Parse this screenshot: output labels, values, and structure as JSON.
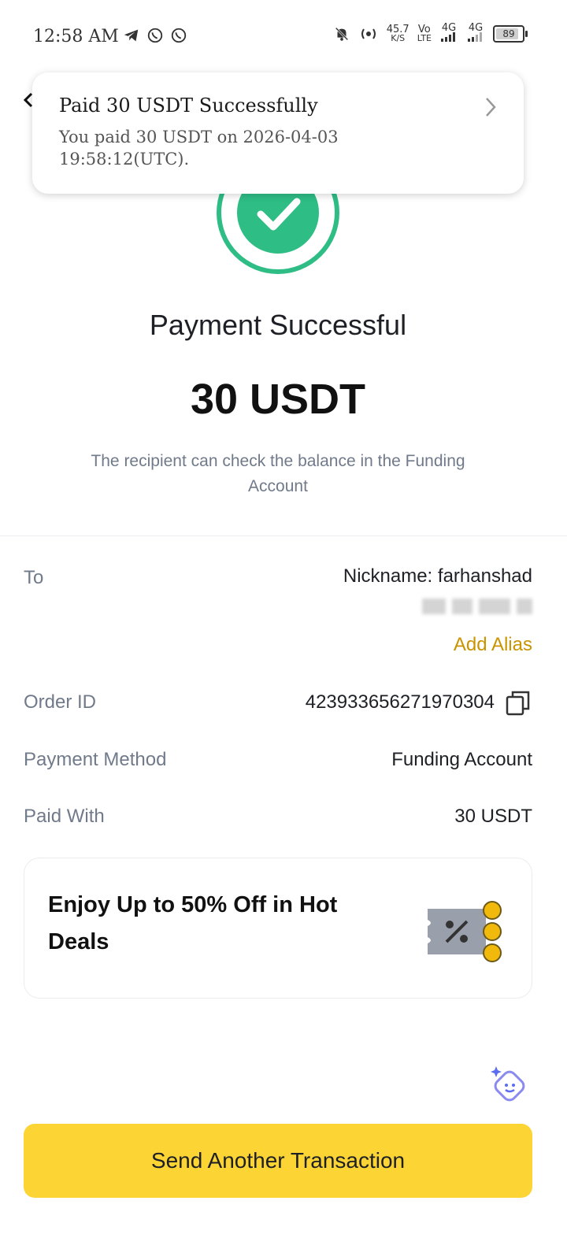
{
  "status_bar": {
    "time": "12:58 AM",
    "speed_value": "45.7",
    "speed_unit": "K/S",
    "volte_top": "Vo",
    "volte_bottom": "LTE",
    "network_1": "4G",
    "network_2": "4G",
    "battery": "89",
    "battery_level": 0.89,
    "icons": [
      "telegram-icon",
      "whatsapp-icon",
      "whatsapp-icon",
      "mute-bell-icon",
      "hotspot-icon",
      "signal-icon",
      "signal-icon"
    ]
  },
  "notification": {
    "title": "Paid 30 USDT Successfully",
    "body": "You paid 30 USDT on 2026-04-03 19:58:12(UTC)."
  },
  "result": {
    "title": "Payment Successful",
    "amount": "30 USDT",
    "note": "The recipient can check the balance in the Funding Account"
  },
  "details": {
    "to_label": "To",
    "to_value": "Nickname: farhanshad",
    "add_alias": "Add Alias",
    "order_label": "Order ID",
    "order_value": "423933656271970304",
    "method_label": "Payment Method",
    "method_value": "Funding Account",
    "paid_label": "Paid With",
    "paid_value": "30 USDT"
  },
  "promo": {
    "text": "Enjoy Up to 50% Off in Hot Deals"
  },
  "cta": {
    "label": "Send Another Transaction"
  },
  "colors": {
    "success": "#2ebd85",
    "brand_yellow": "#fcd535",
    "link_gold": "#c99400",
    "muted_text": "#707a8a"
  }
}
